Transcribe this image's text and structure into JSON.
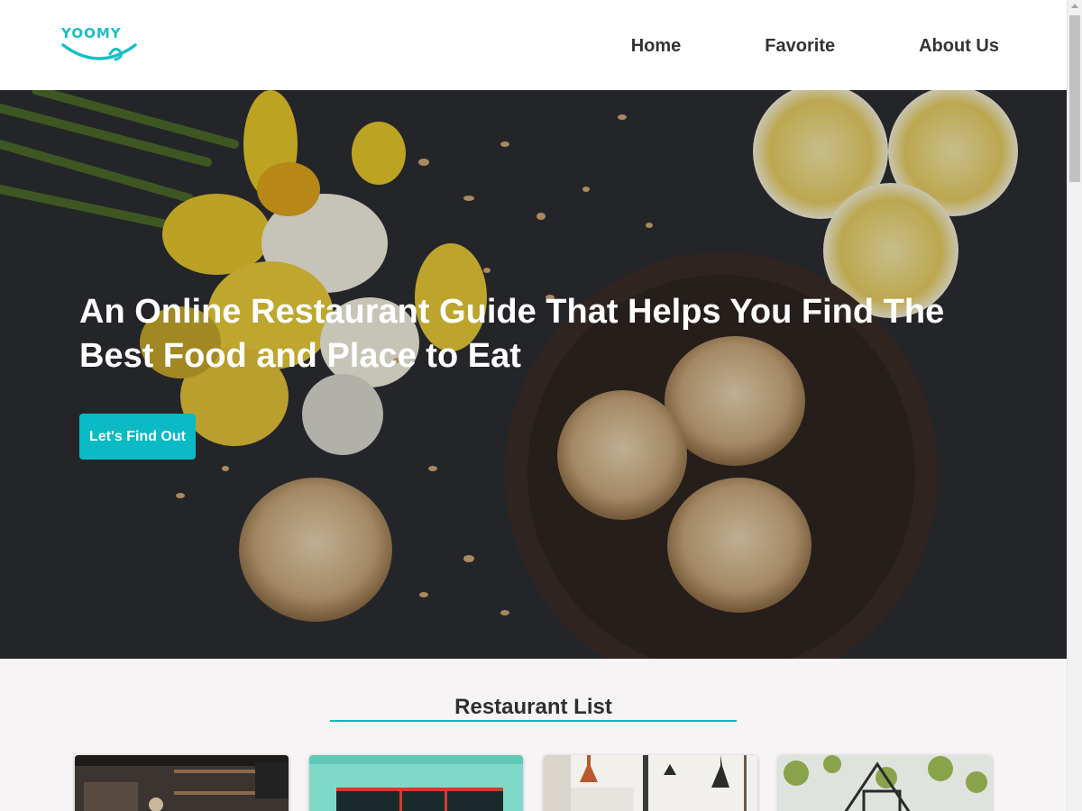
{
  "header": {
    "logo_text": "YOOMY",
    "nav": [
      {
        "label": "Home"
      },
      {
        "label": "Favorite"
      },
      {
        "label": "About Us"
      }
    ]
  },
  "hero": {
    "title": "An Online Restaurant Guide That Helps You Find The Best Food and Place to Eat",
    "button_label": "Let's Find Out"
  },
  "restaurant_list": {
    "title": "Restaurant List",
    "cards": [
      {
        "image": "cafe-interior-photo"
      },
      {
        "image": "teal-storefront-photo"
      },
      {
        "image": "bright-dining-room-photo"
      },
      {
        "image": "greenhouse-cafe-photo"
      }
    ]
  },
  "colors": {
    "accent": "#0abac5",
    "header_bg": "#ffffff",
    "page_bg": "#f7f4f5",
    "nav_text": "#333333"
  }
}
